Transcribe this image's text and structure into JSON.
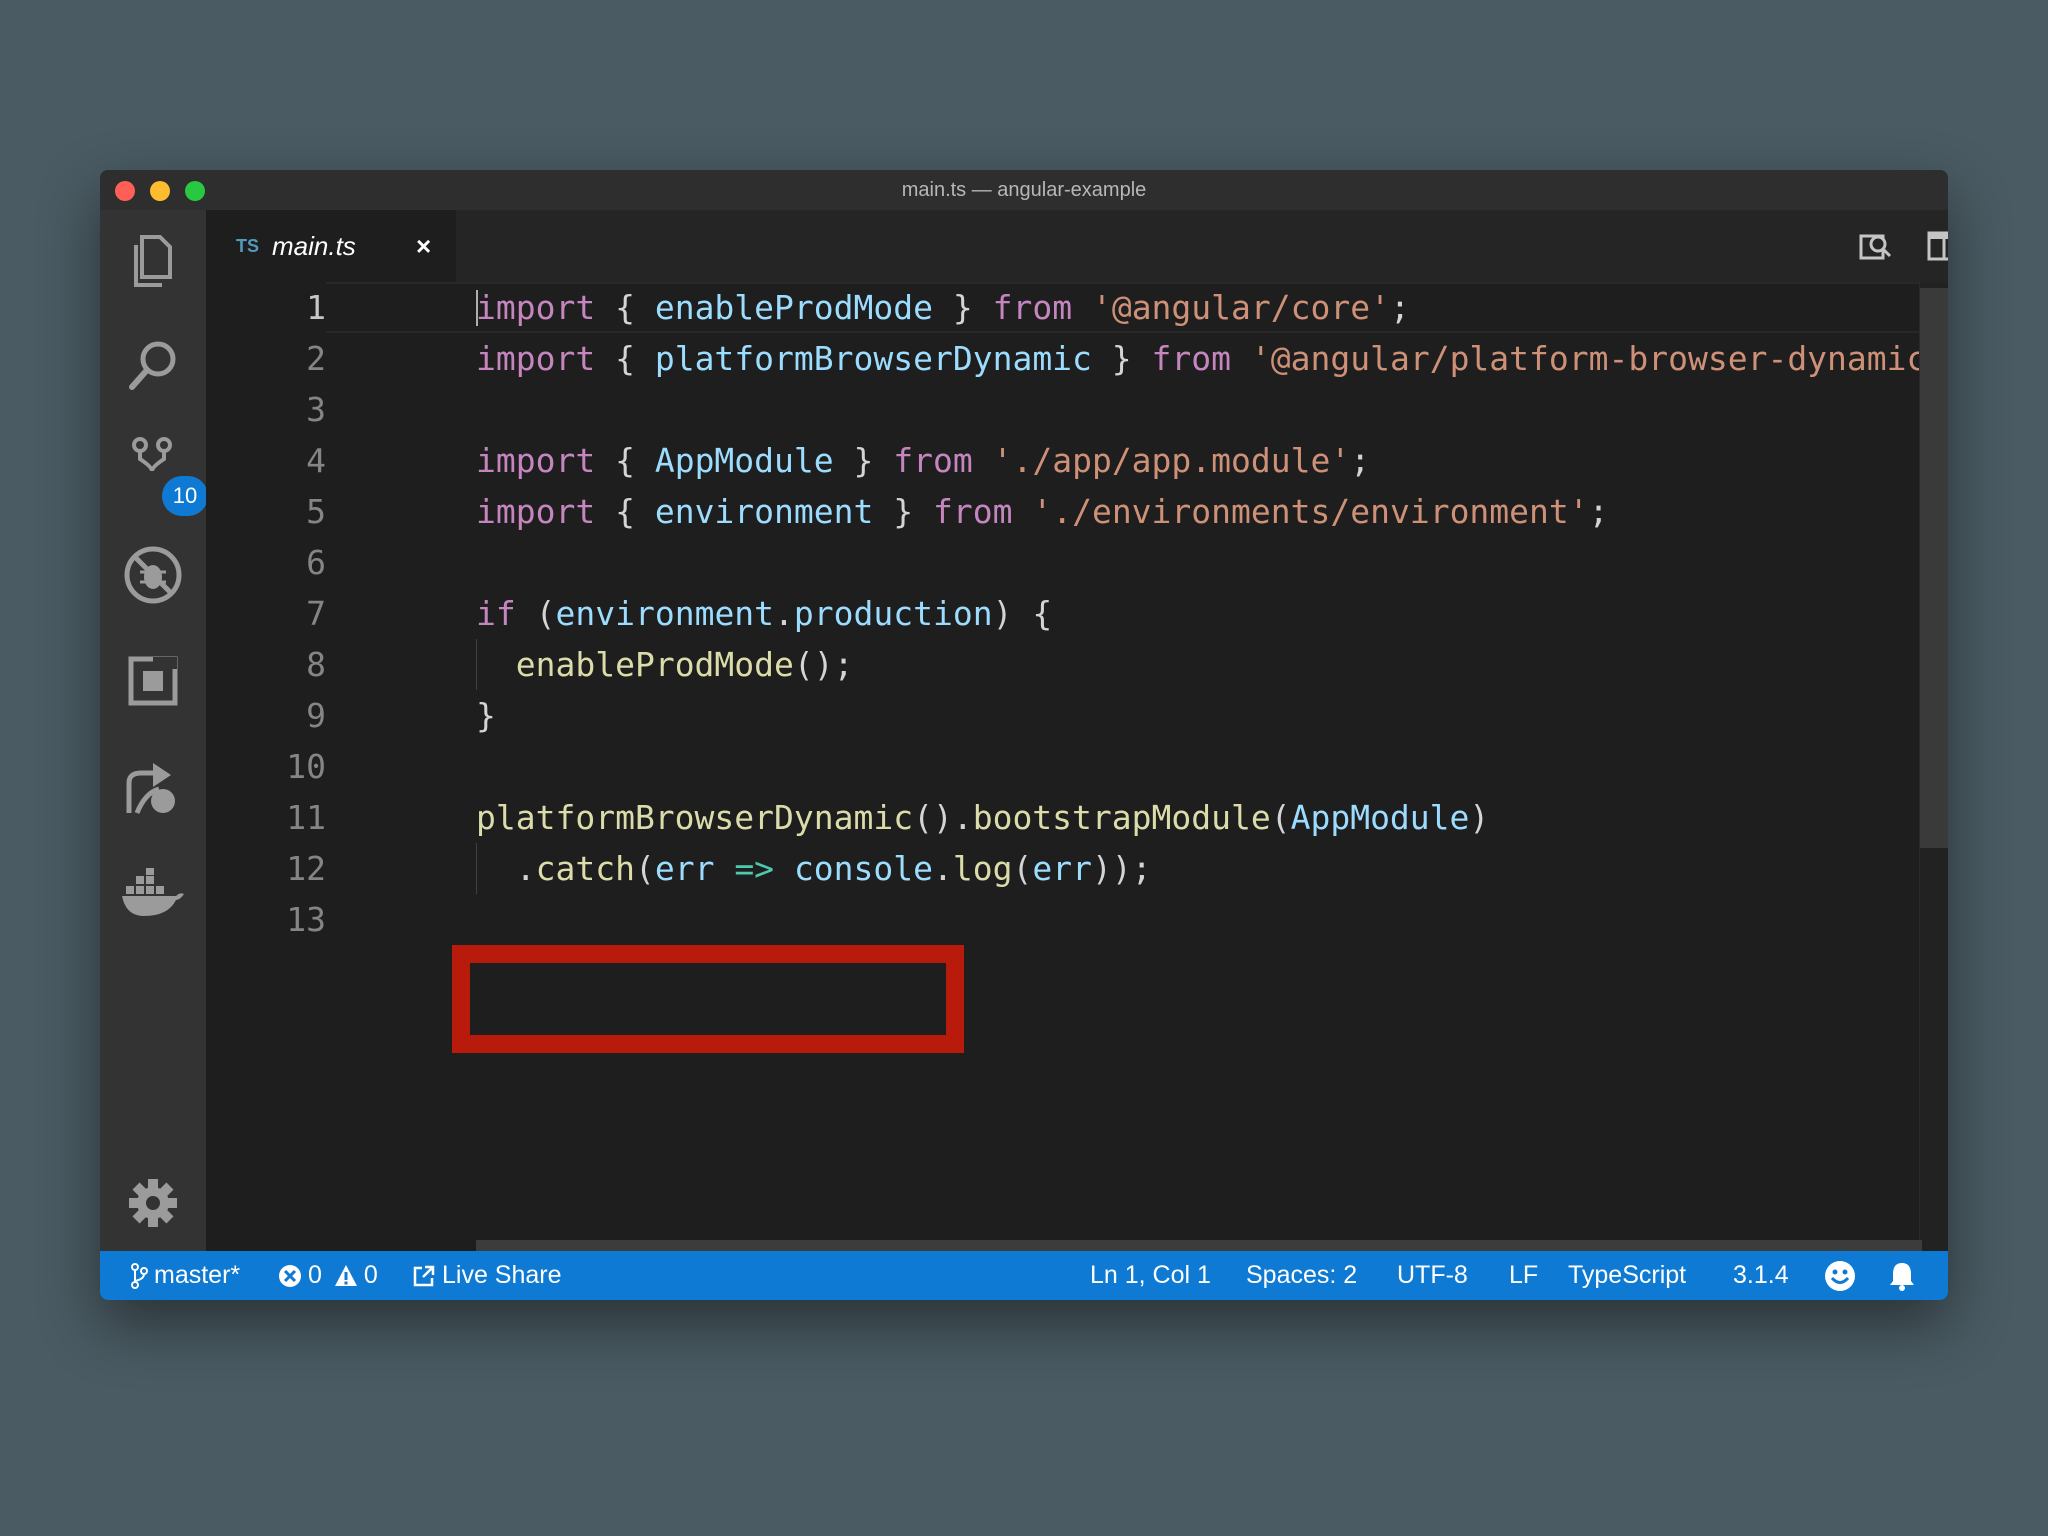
{
  "window": {
    "title": "main.ts — angular-example"
  },
  "activity_bar": {
    "items": [
      {
        "icon": "files-icon"
      },
      {
        "icon": "search-icon"
      },
      {
        "icon": "source-control-icon",
        "badge": "10"
      },
      {
        "icon": "debug-icon"
      },
      {
        "icon": "extensions-icon"
      },
      {
        "icon": "live-share-icon"
      },
      {
        "icon": "docker-icon"
      }
    ],
    "settings_icon": "gear-icon"
  },
  "tabs": [
    {
      "lang_badge": "TS",
      "label": "main.ts",
      "close": "×"
    }
  ],
  "editor": {
    "line_numbers": [
      "1",
      "2",
      "3",
      "4",
      "5",
      "6",
      "7",
      "8",
      "9",
      "10",
      "11",
      "12",
      "13"
    ],
    "lines": [
      "import { enableProdMode } from '@angular/core';",
      "import { platformBrowserDynamic } from '@angular/platform-browser-dynamic';",
      "",
      "import { AppModule } from './app/app.module';",
      "import { environment } from './environments/environment';",
      "",
      "if (environment.production) {",
      "  enableProdMode();",
      "}",
      "",
      "platformBrowserDynamic().bootstrapModule(AppModule)",
      "  .catch(err => console.log(err));",
      ""
    ],
    "tokens": {
      "import": "import",
      "from": "from",
      "if": "if",
      "enableProdMode": "enableProdMode",
      "platformBrowserDynamic": "platformBrowserDynamic",
      "AppModule": "AppModule",
      "environment": "environment",
      "production": "production",
      "bootstrapModule": "bootstrapModule",
      "catch": "catch",
      "err": "err",
      "console": "console",
      "log": "log",
      "str_core": "'@angular/core'",
      "str_pbd": "'@angular/platform-browser-dynamic'",
      "str_app": "'./app/app.module'",
      "str_env": "'./environments/environment'"
    }
  },
  "status_bar": {
    "branch": "master*",
    "errors": "0",
    "warnings": "0",
    "live_share": "Live Share",
    "cursor": "Ln 1, Col 1",
    "spaces": "Spaces: 2",
    "encoding": "UTF-8",
    "eol": "LF",
    "language": "TypeScript",
    "version": "3.1.4"
  },
  "colors": {
    "status_bar": "#0e7ad3",
    "highlight_box": "#b81a0c",
    "keyword": "#c586c0",
    "identifier": "#9cdcfe",
    "function": "#dcdcaa",
    "string": "#ce9178"
  }
}
